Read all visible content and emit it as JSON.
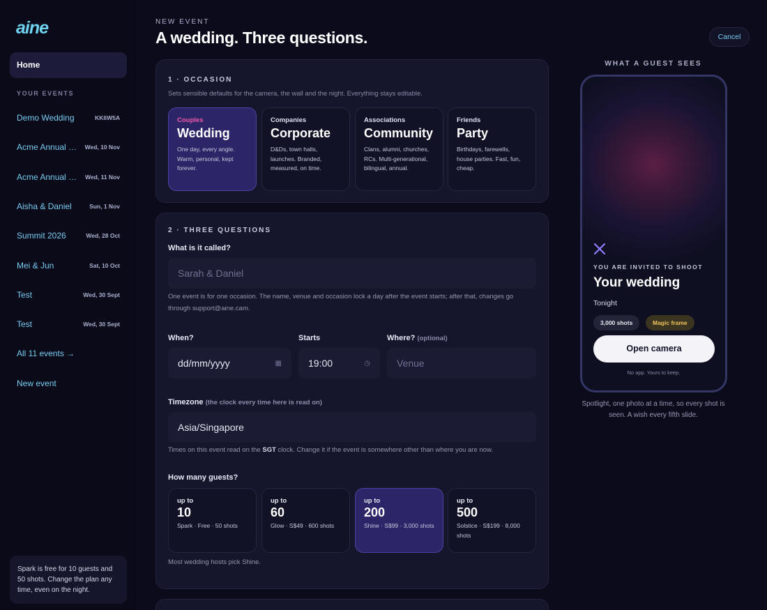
{
  "brand": {
    "logo_text": "aine"
  },
  "sidebar": {
    "home_label": "Home",
    "section_label": "YOUR EVENTS",
    "events": [
      {
        "name": "Demo Wedding",
        "meta": "KK6W5A"
      },
      {
        "name": "Acme Annual Dinner",
        "meta": "Wed, 10 Nov"
      },
      {
        "name": "Acme Annual Dinner",
        "meta": "Wed, 11 Nov"
      },
      {
        "name": "Aisha & Daniel",
        "meta": "Sun, 1 Nov"
      },
      {
        "name": "Summit 2026",
        "meta": "Wed, 28 Oct"
      },
      {
        "name": "Mei & Jun",
        "meta": "Sat, 10 Oct"
      },
      {
        "name": "Test",
        "meta": "Wed, 30 Sept"
      },
      {
        "name": "Test",
        "meta": "Wed, 30 Sept"
      }
    ],
    "all_events_link": "All 11 events →",
    "new_event_link": "New event",
    "plan_note": "Spark is free for 10 guests and 50 shots. Change the plan any time, even on the night."
  },
  "header": {
    "eyebrow": "NEW EVENT",
    "title": "A wedding. Three questions.",
    "cancel_label": "Cancel"
  },
  "occasion": {
    "heading": "1 · OCCASION",
    "subtitle": "Sets sensible defaults for the camera, the wall and the night. Everything stays editable.",
    "selected_index": 0,
    "options": [
      {
        "kicker": "Couples",
        "title": "Wedding",
        "desc": "One day, every angle. Warm, personal, kept forever."
      },
      {
        "kicker": "Companies",
        "title": "Corporate",
        "desc": "D&Ds, town halls, launches. Branded, measured, on time."
      },
      {
        "kicker": "Associations",
        "title": "Community",
        "desc": "Clans, alumni, churches, RCs. Multi-generational, bilingual, annual."
      },
      {
        "kicker": "Friends",
        "title": "Party",
        "desc": "Birthdays, farewells, house parties. Fast, fun, cheap."
      }
    ]
  },
  "questions": {
    "heading": "2 · THREE QUESTIONS",
    "name_label": "What is it called?",
    "name_placeholder": "Sarah & Daniel",
    "name_help": "One event is for one occasion. The name, venue and occasion lock a day after the event starts; after that, changes go through support@aine.cam.",
    "when_label": "When?",
    "when_value": "dd/mm/yyyy",
    "starts_label": "Starts",
    "starts_value": "19:00",
    "where_label": "Where?",
    "where_optional": "(optional)",
    "where_placeholder": "Venue",
    "timezone_label": "Timezone",
    "timezone_note": "(the clock every time here is read on)",
    "timezone_value": "Asia/Singapore",
    "timezone_help_pre": "Times on this event read on the ",
    "timezone_help_code": "SGT",
    "timezone_help_post": " clock. Change it if the event is somewhere other than where you are now.",
    "guests_label": "How many guests?",
    "guests_selected_index": 2,
    "guest_options": [
      {
        "up_to": "up to",
        "count": "10",
        "plan": "Spark · Free · 50 shots"
      },
      {
        "up_to": "up to",
        "count": "60",
        "plan": "Glow · S$49 · 600 shots"
      },
      {
        "up_to": "up to",
        "count": "200",
        "plan": "Shine · S$99 · 3,000 shots"
      },
      {
        "up_to": "up to",
        "count": "500",
        "plan": "Solstice · S$199 · 8,000 shots"
      }
    ],
    "guests_help": "Most wedding hosts pick Shine."
  },
  "preview": {
    "caption": "WHAT A GUEST SEES",
    "invited": "YOU ARE INVITED TO SHOOT",
    "title": "Your wedding",
    "when": "Tonight",
    "shots_chip": "3,000 shots",
    "frame_chip": "Magic frame",
    "cta": "Open camera",
    "footnote": "No app. Yours to keep.",
    "note": "Spotlight, one photo at a time, so every shot is seen. A wish every fifth slide."
  },
  "colors": {
    "accent": "#79cdf2",
    "selected_card": "#2c2568",
    "kicker_pink": "#f05aa8",
    "chip_gold": "#f0c45a"
  }
}
